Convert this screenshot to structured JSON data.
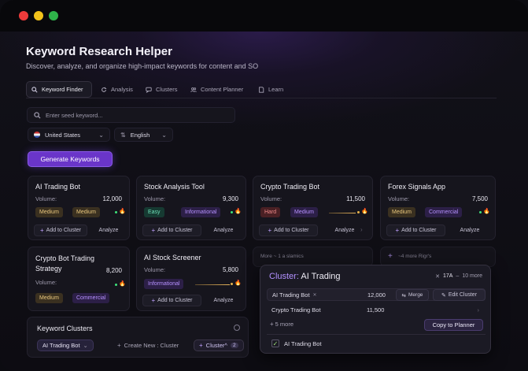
{
  "app": {
    "title": "Keyword Research Helper",
    "subtitle": "Discover, analyze, and organize high-impact keywords for content and SO"
  },
  "tabs": [
    {
      "label": "Keyword Finder",
      "icon": "search-icon",
      "active": true
    },
    {
      "label": "Analysis",
      "icon": "refresh-icon",
      "active": false
    },
    {
      "label": "Clusters",
      "icon": "chat-icon",
      "active": false
    },
    {
      "label": "Content Planner",
      "icon": "people-icon",
      "active": false
    },
    {
      "label": "Learn",
      "icon": "book-icon",
      "active": false
    }
  ],
  "search": {
    "placeholder": "Enter seed keyword..."
  },
  "filters": {
    "country": "United States",
    "language": "English"
  },
  "generate_label": "Generate Keywords",
  "labels": {
    "volume": "Volume:",
    "add_to_cluster": "Add to Cluster",
    "analyze": "Analyze"
  },
  "cards": [
    {
      "title": "AI Trading Bot",
      "volume": "12,000",
      "tags": [
        "Medium",
        "Medium"
      ]
    },
    {
      "title": "Stock Analysis Tool",
      "volume": "9,300",
      "tags": [
        "Easy",
        "Informational"
      ]
    },
    {
      "title": "Crypto Trading Bot",
      "volume": "11,500",
      "tags": [
        "Hard",
        "Medium"
      ]
    },
    {
      "title": "Forex Signals App",
      "volume": "7,500",
      "tags": [
        "Medium",
        "Commercial"
      ]
    },
    {
      "title": "Crypto Bot Trading Strategy",
      "volume": "8,200",
      "tags": [
        "Medium",
        "Commercial"
      ]
    },
    {
      "title": "AI Stock Screener",
      "volume": "5,800",
      "tags": [
        "Informational"
      ]
    }
  ],
  "more_notes": {
    "left": "More ~ 1 a slamics",
    "right": "~4 more Rigr's"
  },
  "keyword_clusters": {
    "title": "Keyword Clusters",
    "selected": "AI Trading Bot",
    "create_new": "Create New : Cluster",
    "cluster_label": "Cluster^",
    "cluster_count": "2"
  },
  "popup": {
    "title_prefix": "Cluster:",
    "title_name": "AI Trading",
    "count_label": "17A",
    "more_label": "10 more",
    "rows": [
      {
        "name": "AI Trading Bot",
        "volume": "12,000"
      },
      {
        "name": "Crypto Trading Bot",
        "volume": "11,500"
      }
    ],
    "merge_label": "Merge",
    "edit_label": "Edit Cluster",
    "more_rows": "5 more",
    "copy_label": "Copy to Planner",
    "checked_item": "AI Trading Bot"
  },
  "colors": {
    "accent": "#6a35c9",
    "background": "#0d0c12",
    "card": "#16151d"
  }
}
